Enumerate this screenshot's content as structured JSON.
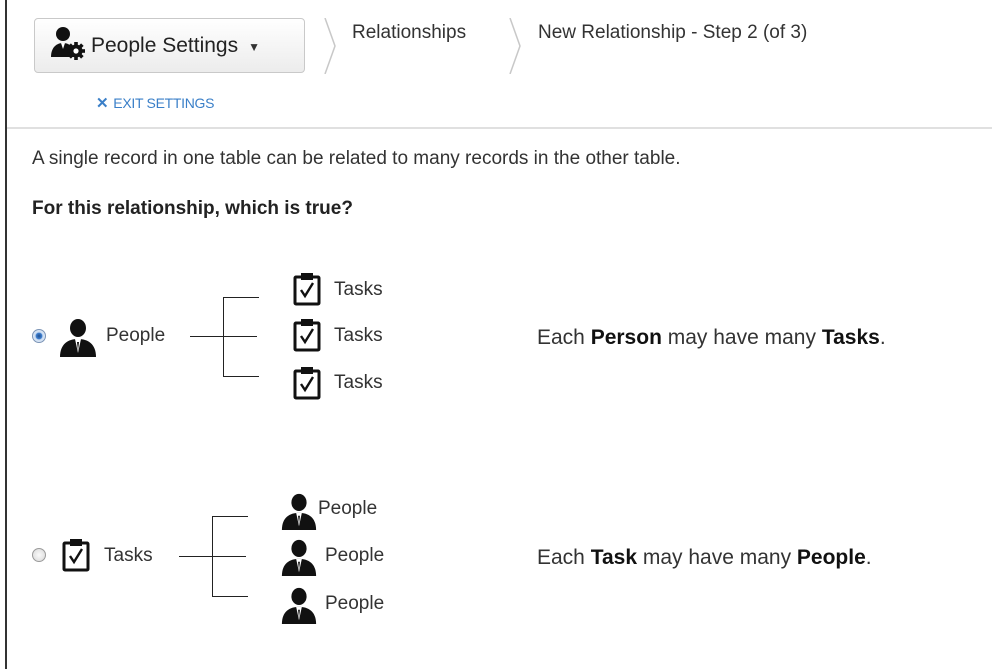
{
  "header": {
    "settings_label": "People Settings",
    "crumbs": [
      "Relationships",
      "New Relationship - Step 2 (of 3)"
    ],
    "exit_label": "EXIT SETTINGS"
  },
  "content": {
    "intro": "A single record in one table can be related to many records in the other table.",
    "question": "For this relationship, which is true?"
  },
  "options": [
    {
      "selected": true,
      "source": "People",
      "targets": [
        "Tasks",
        "Tasks",
        "Tasks"
      ],
      "desc": {
        "pre": "Each ",
        "b1": "Person",
        "mid": " may have many ",
        "b2": "Tasks",
        "post": "."
      }
    },
    {
      "selected": false,
      "source": "Tasks",
      "targets": [
        "People",
        "People",
        "People"
      ],
      "desc": {
        "pre": "Each ",
        "b1": "Task",
        "mid": " may have many ",
        "b2": "People",
        "post": "."
      }
    }
  ],
  "icons": {
    "person": "person-icon",
    "task": "clipboard-check-icon",
    "gear": "gear-icon"
  }
}
